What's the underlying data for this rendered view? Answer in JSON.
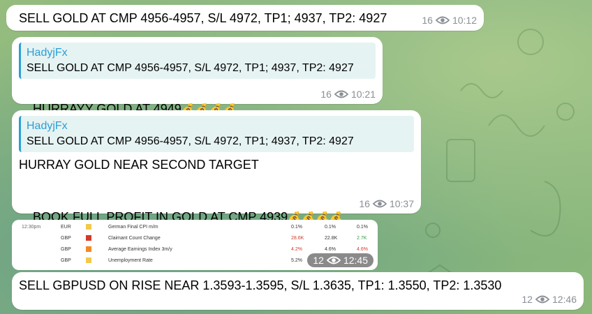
{
  "messages": [
    {
      "text": "SELL GOLD AT CMP 4956-4957, S/L 4972, TP1; 4937, TP2: 4927",
      "views": "16",
      "time": "10:12"
    },
    {
      "reply_author": "HadyjFx",
      "reply_text": "SELL GOLD AT CMP 4956-4957, S/L 4972, TP1; 4937, TP2: 4927",
      "text": "HURRAYY GOLD AT 4949",
      "emoji": "💰💰💰💰",
      "views": "16",
      "time": "10:21"
    },
    {
      "reply_author": "HadyjFx",
      "reply_text": "SELL GOLD AT CMP 4956-4957, S/L 4972, TP1; 4937, TP2: 4927",
      "text_line1": "HURRAY GOLD NEAR SECOND TARGET",
      "text_line2": "BOOK FULL PROFIT IN GOLD AT CMP 4939",
      "emoji": "💰💰💰💰",
      "views": "16",
      "time": "10:37"
    },
    {
      "views": "12",
      "time": "12:45"
    },
    {
      "text": "SELL GBPUSD ON RISE NEAR 1.3593-1.3595, S/L 1.3635, TP1: 1.3550, TP2: 1.3530",
      "views": "12",
      "time": "12:46"
    }
  ],
  "calendar": {
    "time": "12:30pm",
    "rows": [
      {
        "currency": "EUR",
        "event": "German Final CPI m/m",
        "actual": "0.1%",
        "forecast": "0.1%",
        "previous": "0.1%",
        "impact_color": "#f2c94c",
        "actual_color": "#333333",
        "previous_color": "#333333"
      },
      {
        "currency": "GBP",
        "event": "Claimant Count Change",
        "actual": "28.6K",
        "forecast": "22.8K",
        "previous": "2.7K",
        "impact_color": "#d23a2a",
        "actual_color": "#d23a2a",
        "previous_color": "#2e9e3e"
      },
      {
        "currency": "GBP",
        "event": "Average Earnings Index 3m/y",
        "actual": "4.2%",
        "forecast": "4.6%",
        "previous": "4.6%",
        "impact_color": "#f08a24",
        "actual_color": "#d23a2a",
        "previous_color": "#d23a2a"
      },
      {
        "currency": "GBP",
        "event": "Unemployment Rate",
        "actual": "5.2%",
        "forecast": "",
        "previous": "",
        "impact_color": "#f2c94c",
        "actual_color": "#333333",
        "previous_color": "#333333"
      }
    ]
  },
  "colors": {
    "accent": "#2a9fd6",
    "meta": "#8a8f94"
  }
}
